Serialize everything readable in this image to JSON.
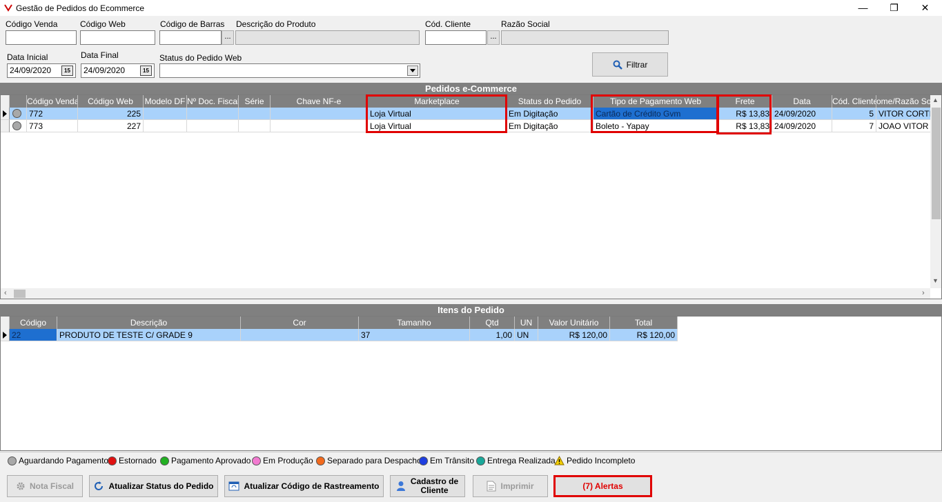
{
  "window": {
    "title": "Gestão de Pedidos do Ecommerce",
    "minimize": "—",
    "maximize": "❐",
    "close": "✕"
  },
  "filters": {
    "codigo_venda": {
      "label": "Código Venda",
      "value": ""
    },
    "codigo_web": {
      "label": "Código Web",
      "value": ""
    },
    "codigo_barras": {
      "label": "Código de Barras",
      "value": ""
    },
    "descricao_produto": {
      "label": "Descrição do Produto",
      "value": ""
    },
    "cod_cliente": {
      "label": "Cód. Cliente",
      "value": ""
    },
    "razao_social": {
      "label": "Razão Social",
      "value": ""
    },
    "data_inicial": {
      "label": "Data Inicial",
      "value": "24/09/2020"
    },
    "data_final": {
      "label": "Data Final",
      "value": "24/09/2020"
    },
    "status_pedido_web": {
      "label": "Status do Pedido Web",
      "value": ""
    },
    "lookup_btn": "...",
    "calendar_btn": "15",
    "filtrar_btn": "Filtrar"
  },
  "pedidos": {
    "title": "Pedidos e-Commerce",
    "columns": [
      "Código Venda",
      "Código Web",
      "Modelo DF",
      "Nº Doc. Fiscal",
      "Série",
      "Chave NF-e",
      "Marketplace",
      "Status do Pedido",
      "Tipo de Pagamento Web",
      "Frete",
      "Data",
      "Cód. Cliente",
      "ome/Razão Soc"
    ],
    "rows": [
      {
        "codigo_venda": "772",
        "codigo_web": "225",
        "modelo_df": "",
        "n_doc": "",
        "serie": "",
        "chave": "",
        "marketplace": "Loja Virtual",
        "status": "Em Digitação",
        "tipo_pagamento": "Cartão de Crédito Gvm",
        "frete": "R$ 13,83",
        "data": "24/09/2020",
        "cod_cliente": "5",
        "nome": "VITOR CORTIN"
      },
      {
        "codigo_venda": "773",
        "codigo_web": "227",
        "modelo_df": "",
        "n_doc": "",
        "serie": "",
        "chave": "",
        "marketplace": "Loja Virtual",
        "status": "Em Digitação",
        "tipo_pagamento": "Boleto - Yapay",
        "frete": "R$ 13,83",
        "data": "24/09/2020",
        "cod_cliente": "7",
        "nome": "JOAO VITOR R"
      }
    ]
  },
  "itens": {
    "title": "Itens do Pedido",
    "columns": [
      "Código",
      "Descrição",
      "Cor",
      "Tamanho",
      "Qtd",
      "UN",
      "Valor Unitário",
      "Total"
    ],
    "rows": [
      {
        "codigo": "22",
        "descricao": "PRODUTO DE TESTE C/ GRADE 9",
        "cor": "",
        "tamanho": "37",
        "qtd": "1,00",
        "un": "UN",
        "valor_unitario": "R$ 120,00",
        "total": "R$ 120,00"
      }
    ]
  },
  "legend": [
    {
      "label": "Aguardando Pagamento",
      "color": "#a8a8a8"
    },
    {
      "label": "Estornado",
      "color": "#e01010"
    },
    {
      "label": "Pagamento Aprovado",
      "color": "#22b022"
    },
    {
      "label": "Em Produção",
      "color": "#f27ad0"
    },
    {
      "label": "Separado para Despacho",
      "color": "#f26a1e"
    },
    {
      "label": "Em Trânsito",
      "color": "#1e3ee0"
    },
    {
      "label": "Entrega Realizada",
      "color": "#1aa89a"
    },
    {
      "label": "Pedido Incompleto",
      "icon": "warning-icon"
    }
  ],
  "footer": {
    "nota_fiscal": "Nota Fiscal",
    "atualizar_status": "Atualizar Status do Pedido",
    "atualizar_rastreamento": "Atualizar Código de Rastreamento",
    "cadastro_cliente": "Cadastro de Cliente",
    "imprimir": "Imprimir",
    "alertas": "(7) Alertas"
  },
  "colors": {
    "highlight": "#e00000",
    "alert_text": "#e00000",
    "selection": "#a9d2fb"
  }
}
